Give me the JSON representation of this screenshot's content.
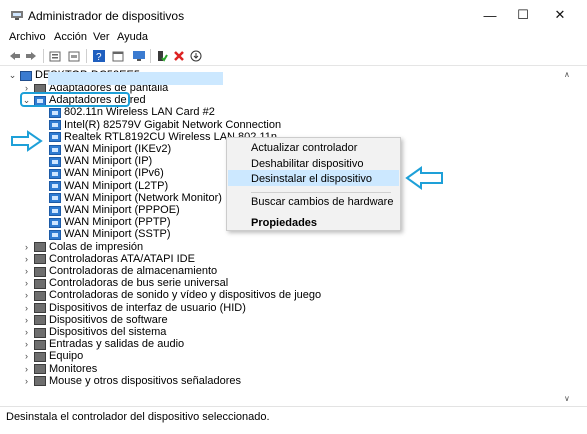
{
  "window": {
    "title": "Administrador de dispositivos",
    "minimize": "—",
    "maximize": "☐",
    "close": "✕"
  },
  "menu": [
    "Archivo",
    "Acción",
    "Ver",
    "Ayuda"
  ],
  "toolbar": {
    "icons": [
      "back-icon",
      "forward-icon",
      "properties-icon",
      "show-hidden-icon",
      "help-icon",
      "view-icon",
      "monitor-icon",
      "enable-driver-icon",
      "uninstall-icon",
      "download-icon"
    ]
  },
  "tree": {
    "root": "DESKTOP-DC52EE5",
    "items": [
      {
        "label": "Adaptadores de pantalla",
        "level": 1,
        "expander": "›"
      },
      {
        "label": "Adaptadores de red",
        "level": 1,
        "expander": "⌄"
      },
      {
        "label": "802.11n Wireless LAN Card #2",
        "level": 2,
        "expander": ""
      },
      {
        "label": "Intel(R) 82579V Gigabit Network Connection",
        "level": 2,
        "expander": ""
      },
      {
        "label": "Realtek RTL8192CU Wireless LAN 802.11n",
        "level": 2,
        "expander": ""
      },
      {
        "label": "WAN Miniport (IKEv2)",
        "level": 2,
        "expander": ""
      },
      {
        "label": "WAN Miniport (IP)",
        "level": 2,
        "expander": ""
      },
      {
        "label": "WAN Miniport (IPv6)",
        "level": 2,
        "expander": ""
      },
      {
        "label": "WAN Miniport (L2TP)",
        "level": 2,
        "expander": ""
      },
      {
        "label": "WAN Miniport (Network Monitor)",
        "level": 2,
        "expander": ""
      },
      {
        "label": "WAN Miniport (PPPOE)",
        "level": 2,
        "expander": ""
      },
      {
        "label": "WAN Miniport (PPTP)",
        "level": 2,
        "expander": ""
      },
      {
        "label": "WAN Miniport (SSTP)",
        "level": 2,
        "expander": ""
      },
      {
        "label": "Colas de impresión",
        "level": 1,
        "expander": "›"
      },
      {
        "label": "Controladoras ATA/ATAPI IDE",
        "level": 1,
        "expander": "›"
      },
      {
        "label": "Controladoras de almacenamiento",
        "level": 1,
        "expander": "›"
      },
      {
        "label": "Controladoras de bus serie universal",
        "level": 1,
        "expander": "›"
      },
      {
        "label": "Controladoras de sonido y vídeo y dispositivos de juego",
        "level": 1,
        "expander": "›"
      },
      {
        "label": "Dispositivos de interfaz de usuario (HID)",
        "level": 1,
        "expander": "›"
      },
      {
        "label": "Dispositivos de software",
        "level": 1,
        "expander": "›"
      },
      {
        "label": "Dispositivos del sistema",
        "level": 1,
        "expander": "›"
      },
      {
        "label": "Entradas y salidas de audio",
        "level": 1,
        "expander": "›"
      },
      {
        "label": "Equipo",
        "level": 1,
        "expander": "›"
      },
      {
        "label": "Monitores",
        "level": 1,
        "expander": "›"
      },
      {
        "label": "Mouse y otros dispositivos señaladores",
        "level": 1,
        "expander": "›"
      }
    ]
  },
  "context_menu": {
    "items": [
      "Actualizar controlador",
      "Deshabilitar dispositivo",
      "Desinstalar el dispositivo",
      "Buscar cambios de hardware",
      "Propiedades"
    ]
  },
  "status": "Desinstala el controlador del dispositivo seleccionado.",
  "colors": {
    "annotation": "#1ea0d8",
    "selection": "#cce8ff",
    "net_icon": "#2f7bd1"
  }
}
